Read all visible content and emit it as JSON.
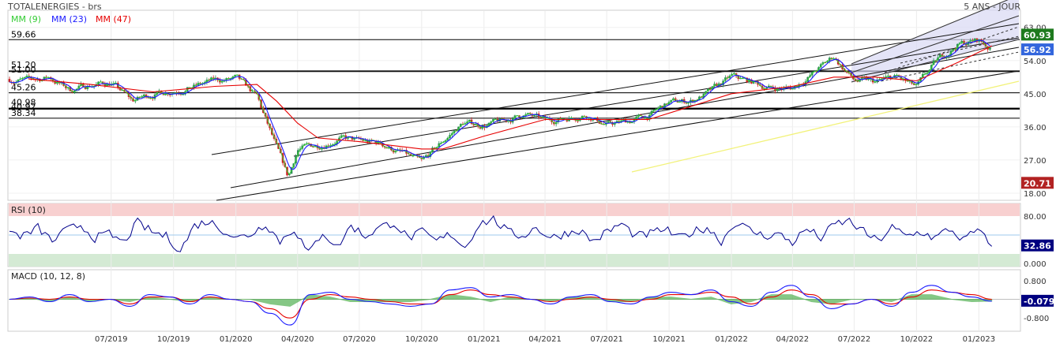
{
  "header": {
    "title": "TOTALENERGIES - brs",
    "period": "5 ANS - JOUR"
  },
  "legend": [
    {
      "label": "MM (9)",
      "color": "#33cc33"
    },
    {
      "label": "MM (23)",
      "color": "#1a1aff"
    },
    {
      "label": "MM (47)",
      "color": "#e60000"
    }
  ],
  "colors": {
    "up": "#2e8b57",
    "down": "#cc2222",
    "ma9": "#33cc33",
    "ma23": "#1a1aff",
    "ma47": "#e60000",
    "rsi": "#00008b",
    "macd": "#1a1aff",
    "signal": "#e60000",
    "histo": "#44aa44",
    "badge_green": "#1e7a1e",
    "badge_blue": "#3366dd",
    "badge_red": "#b22222",
    "badge_navy": "#000080"
  },
  "chart_data": [
    {
      "type": "candlestick",
      "x_labels": [
        "07/2019",
        "10/2019",
        "01/2020",
        "04/2020",
        "07/2020",
        "10/2020",
        "01/2021",
        "04/2021",
        "07/2021",
        "10/2021",
        "01/2022",
        "04/2022",
        "07/2022",
        "10/2022",
        "01/2023"
      ],
      "x_range": [
        "2019-02",
        "2023-03"
      ],
      "ylim": [
        16.5,
        67
      ],
      "y_ticks": [
        "63.00",
        "54.00",
        "45.00",
        "36.00",
        "27.00",
        "18.00"
      ],
      "levels": [
        "59.66",
        "51.20",
        "51.00",
        "45.26",
        "40.98",
        "40.92",
        "38.34"
      ],
      "last_price": "56.92",
      "badge_high": "60.93",
      "badge_low": "20.71",
      "close_approx": [
        [
          "2019-02",
          49.0
        ],
        [
          "2019-03",
          48.5
        ],
        [
          "2019-04",
          49.5
        ],
        [
          "2019-05",
          46.0
        ],
        [
          "2019-06",
          47.5
        ],
        [
          "2019-07",
          48.0
        ],
        [
          "2019-08",
          43.0
        ],
        [
          "2019-09",
          45.0
        ],
        [
          "2019-10",
          46.0
        ],
        [
          "2019-11",
          47.0
        ],
        [
          "2019-12",
          48.5
        ],
        [
          "2020-01",
          49.0
        ],
        [
          "2020-02",
          44.0
        ],
        [
          "2020-03",
          30.0
        ],
        [
          "2020-03-18",
          22.0
        ],
        [
          "2020-04",
          30.0
        ],
        [
          "2020-05",
          31.0
        ],
        [
          "2020-06",
          33.0
        ],
        [
          "2020-07",
          32.0
        ],
        [
          "2020-08",
          31.5
        ],
        [
          "2020-09",
          29.0
        ],
        [
          "2020-10",
          26.0
        ],
        [
          "2020-11",
          32.0
        ],
        [
          "2020-12",
          37.0
        ],
        [
          "2021-01",
          36.5
        ],
        [
          "2021-02",
          37.5
        ],
        [
          "2021-03",
          39.5
        ],
        [
          "2021-04",
          37.5
        ],
        [
          "2021-05",
          38.5
        ],
        [
          "2021-06",
          39.5
        ],
        [
          "2021-07",
          36.5
        ],
        [
          "2021-08",
          37.5
        ],
        [
          "2021-09",
          39.0
        ],
        [
          "2021-10",
          42.5
        ],
        [
          "2021-11",
          43.0
        ],
        [
          "2021-12",
          45.5
        ],
        [
          "2022-01",
          49.5
        ],
        [
          "2022-02",
          48.0
        ],
        [
          "2022-03",
          46.5
        ],
        [
          "2022-04",
          46.5
        ],
        [
          "2022-05",
          50.5
        ],
        [
          "2022-06",
          55.0
        ],
        [
          "2022-07",
          48.5
        ],
        [
          "2022-08",
          48.0
        ],
        [
          "2022-09",
          49.5
        ],
        [
          "2022-10",
          46.5
        ],
        [
          "2022-11",
          54.0
        ],
        [
          "2022-12",
          58.5
        ],
        [
          "2023-01",
          59.5
        ],
        [
          "2023-01-20",
          57.0
        ]
      ],
      "ma47_approx": [
        [
          "2019-03",
          49.0
        ],
        [
          "2019-06",
          47.5
        ],
        [
          "2019-09",
          45.5
        ],
        [
          "2019-12",
          47.0
        ],
        [
          "2020-02",
          47.5
        ],
        [
          "2020-03",
          43.0
        ],
        [
          "2020-04",
          37.0
        ],
        [
          "2020-05",
          33.0
        ],
        [
          "2020-07",
          32.0
        ],
        [
          "2020-10",
          30.0
        ],
        [
          "2020-11",
          30.0
        ],
        [
          "2021-01",
          33.5
        ],
        [
          "2021-04",
          38.0
        ],
        [
          "2021-07",
          38.0
        ],
        [
          "2021-09",
          38.0
        ],
        [
          "2021-11",
          41.5
        ],
        [
          "2022-01",
          45.0
        ],
        [
          "2022-04",
          47.0
        ],
        [
          "2022-06",
          49.5
        ],
        [
          "2022-08",
          49.5
        ],
        [
          "2022-10",
          48.5
        ],
        [
          "2022-12",
          53.5
        ],
        [
          "2023-01-20",
          58.0
        ]
      ]
    },
    {
      "type": "line",
      "title": "RSI (10)",
      "ylim": [
        0,
        100
      ],
      "y_ticks": [
        "80.00",
        "0.000"
      ],
      "last_value": "32.86",
      "values_approx": [
        55,
        48,
        62,
        40,
        58,
        66,
        45,
        52,
        38,
        70,
        55,
        48,
        25,
        65,
        72,
        58,
        45,
        52,
        68,
        40,
        60,
        20,
        55,
        30,
        65,
        48,
        62,
        70,
        45,
        55,
        40,
        52,
        30,
        68,
        75,
        55,
        48,
        62,
        45,
        52,
        58,
        40,
        55,
        68,
        48,
        52,
        60,
        45,
        55,
        62,
        40,
        70,
        58,
        48,
        52,
        38,
        60,
        45,
        68,
        72,
        55,
        40,
        62,
        48,
        55,
        45,
        60,
        42,
        58,
        32
      ]
    },
    {
      "type": "line",
      "title": "MACD (10, 12, 8)",
      "ylim": [
        -1.3,
        1.2
      ],
      "y_ticks": [
        "0.800",
        "-0.800"
      ],
      "last_value": "-0.079",
      "macd_approx": [
        0,
        0.1,
        -0.1,
        0.2,
        -0.1,
        0,
        -0.3,
        0.2,
        0.1,
        -0.2,
        0.2,
        0,
        -0.1,
        -0.6,
        -1.1,
        0.2,
        0.3,
        0,
        -0.1,
        -0.2,
        -0.3,
        -0.2,
        0.4,
        0.5,
        0.1,
        0.2,
        0,
        -0.2,
        0.1,
        0.2,
        -0.1,
        -0.2,
        0.1,
        0.3,
        0.2,
        0.4,
        -0.1,
        -0.3,
        0.3,
        0.6,
        0.1,
        -0.4,
        -0.2,
        0,
        -0.3,
        0.3,
        0.6,
        0.3,
        0.1,
        -0.08
      ],
      "signal_approx": [
        0,
        0.05,
        0,
        0.1,
        0,
        0,
        -0.2,
        0.1,
        0.1,
        -0.1,
        0.1,
        0,
        -0.1,
        -0.4,
        -0.8,
        0,
        0.2,
        0.1,
        0,
        -0.1,
        -0.2,
        -0.2,
        0.2,
        0.4,
        0.2,
        0.1,
        0,
        -0.1,
        0,
        0.1,
        0,
        -0.1,
        0,
        0.2,
        0.2,
        0.3,
        0.1,
        -0.2,
        0.1,
        0.4,
        0.2,
        -0.2,
        -0.2,
        0,
        -0.2,
        0.1,
        0.4,
        0.3,
        0.2,
        0.0
      ]
    }
  ]
}
